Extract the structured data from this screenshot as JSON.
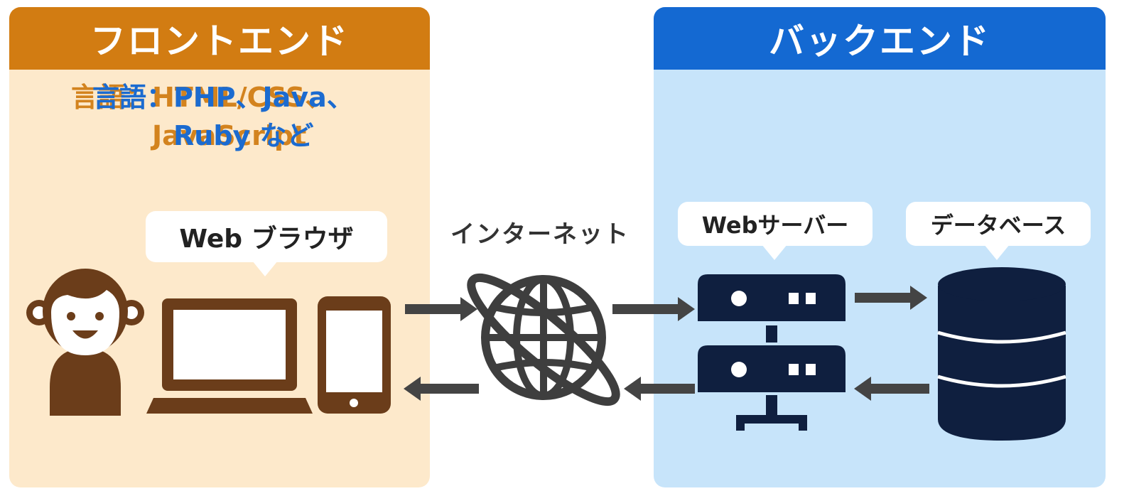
{
  "frontend": {
    "title": "フロントエンド",
    "lang_label": "言語：",
    "lang_line1": "HTML/CSS、",
    "lang_line2": "JavaScript",
    "bubble": "Web ブラウザ"
  },
  "backend": {
    "title": "バックエンド",
    "lang_label": "言語：",
    "lang_line1": "PHP、Java、",
    "lang_line2": "Ruby など",
    "server_bubble": "Webサーバー",
    "db_bubble": "データベース"
  },
  "network": {
    "label": "インターネット"
  },
  "colors": {
    "front_header": "#d27c12",
    "front_bg": "#fde9cb",
    "back_header": "#1469d2",
    "back_bg": "#c7e4fa",
    "device_brown": "#6b3d1a",
    "server_navy": "#0f1f3f",
    "arrow_gray": "#444444"
  },
  "icons": [
    "person-icon",
    "laptop-icon",
    "smartphone-icon",
    "globe-icon",
    "server-icon",
    "database-icon",
    "arrow-right-icon",
    "arrow-left-icon"
  ]
}
